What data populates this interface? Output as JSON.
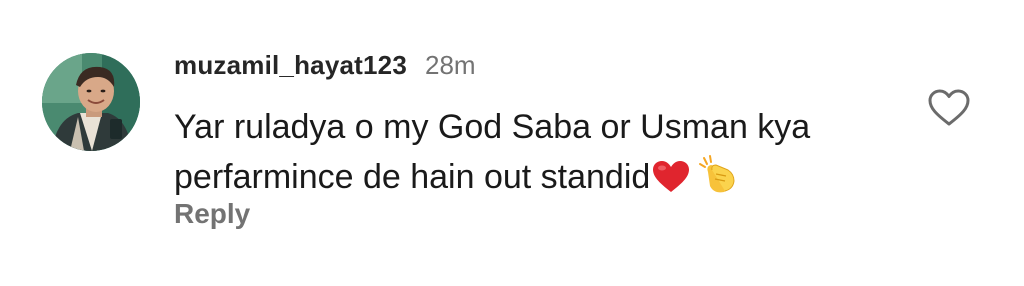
{
  "comment": {
    "username": "muzamil_hayat123",
    "timestamp": "28m",
    "text_line1": "Yar ruladya o my God Saba or Usman kya",
    "text_line2": "perfarmince de hain out standid",
    "emojis": [
      "red-heart",
      "clapping-hands"
    ],
    "reply_label": "Reply",
    "like_icon": "heart-outline-icon"
  },
  "colors": {
    "username": "#262626",
    "secondary": "#737373",
    "text": "#1a1a1a",
    "heart_emoji": "#e0252e",
    "clap_emoji": "#f5c518"
  }
}
